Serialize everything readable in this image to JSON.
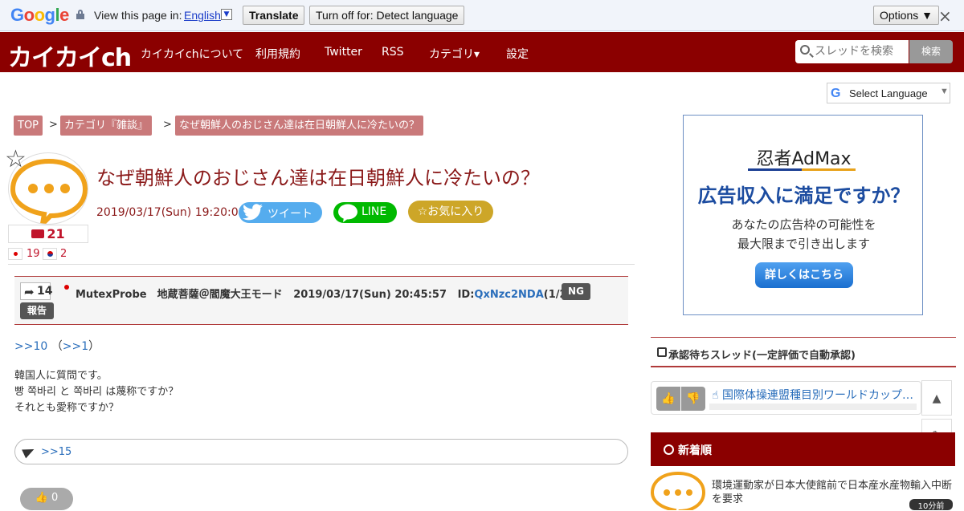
{
  "translate_bar": {
    "logo_letters": [
      "G",
      "o",
      "o",
      "g",
      "l",
      "e"
    ],
    "prompt": "View this page in:",
    "language": "English",
    "translate_label": "Translate",
    "turn_off_label": "Turn off for: Detect language",
    "options_label": "Options ▼",
    "close_glyph": "×"
  },
  "header": {
    "logo": "カイカイch",
    "nav": [
      "カイカイchについて",
      "利用規約",
      "Twitter",
      "RSS",
      "カテゴリ▾",
      "設定"
    ],
    "search_placeholder": "スレッドを検索",
    "search_button": "検索",
    "colors": {
      "bar": "#8b0000"
    }
  },
  "select_language": {
    "g": "G",
    "label": "Select Language",
    "arrow": "▼"
  },
  "breadcrumb": {
    "items": [
      "TOP",
      "カテゴリ『雑談』",
      "なぜ朝鮮人のおじさん達は在日朝鮮人に冷たいの？"
    ],
    "separator": ">"
  },
  "thread": {
    "title": "なぜ朝鮮人のおじさん達は在日朝鮮人に冷たいの？",
    "date": "2019/03/17(Sun) 19:20:01",
    "tweet_label": "ツイート",
    "line_label": "LINE",
    "favorite_label": "☆お気に入り",
    "reply_count": "21",
    "jp_count": "19",
    "kr_count": "2",
    "star_glyph": "☆"
  },
  "post": {
    "number": "14",
    "name": "MutexProbe　地蔵菩薩＠閻魔大王モード",
    "datetime": "2019/03/17(Sun) 20:45:57",
    "id_label": "ID:",
    "id": "QxNzc2NDA",
    "id_count": "(1/2)",
    "ng_label": "NG",
    "report_label": "報告",
    "anchor_main": ">>10",
    "anchor_paren_open": "（",
    "anchor_sub": ">>1",
    "anchor_paren_close": "）",
    "body": [
      "韓国人に質問です。",
      "빵 쪽바리 と 쪽바리 は蔑称ですか？",
      "それとも愛称ですか？"
    ],
    "reply_ref": ">>15",
    "likes": "0"
  },
  "ad": {
    "brand": "忍者AdMax",
    "headline": "広告収入に満足ですか？",
    "sub1": "あなたの広告枠の可能性を",
    "sub2": "最大限まで引き出します",
    "cta": "詳しくはこちら"
  },
  "sidebar": {
    "pending_title": "承認待ちスレッド(一定評価で自動承認)",
    "pending_item": "国際体操連盟種目別ワールドカップ…",
    "new_title": "新着順",
    "new_item_text": "環境運動家が日本大使館前で日本産水産物輸入中断を要求",
    "new_item_time": "10分前"
  }
}
